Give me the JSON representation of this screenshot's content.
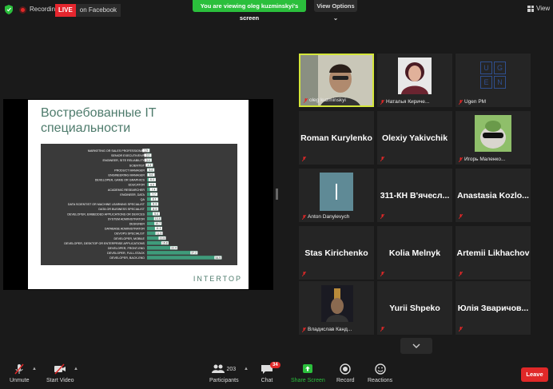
{
  "topbar": {
    "recording": "Recording",
    "live": "LIVE",
    "live_target": "on Facebook",
    "viewing_banner": "You are viewing oleg kuzminskyi's screen",
    "view_options": "View Options",
    "view": "View"
  },
  "slide": {
    "title": "Востребованные IT специальности",
    "logo": "INTERTOP"
  },
  "chart_data": {
    "type": "bar",
    "orientation": "horizontal",
    "categories": [
      "MARKETING OR SALES PROFESSIONAL",
      "SENIOR EXECUTIVE/VP",
      "ENGINEER, SITE RELIABILITY",
      "SCIENTIST",
      "PRODUCT MANAGER",
      "ENGINEERING MANAGER",
      "DEVELOPER, GAME OR GRAPHICS",
      "EDUCATOR",
      "ACADEMIC RESEARCHER",
      "ENGINEER, DATA",
      "QA",
      "DATA SCIENTIST OR MACHINE LEARNING SPECIALIST",
      "DATA OR BUSINESS SPECIALIST",
      "DEVELOPER, EMBEDDED APPLICATIONS OR DEVICES",
      "SYSTEM ADMINISTRATOR",
      "DESIGNER",
      "DATABASE ADMINISTRATOR",
      "DEVOPS SPECIALIST",
      "DEVELOPER, MOBILE",
      "DEVELOPER, DESKTOP OR ENTERPRISE APPLICATIONS",
      "DEVELOPER, FRONT-END",
      "DEVELOPER, FULL-STACK",
      "DEVELOPER, BACK-END"
    ],
    "values": [
      1.9,
      3.2,
      3.4,
      4.3,
      5.4,
      5.6,
      6.4,
      6.5,
      7.4,
      7.7,
      8.1,
      8.3,
      8.3,
      9.4,
      10.4,
      10.7,
      11.1,
      11.5,
      13.8,
      15.8,
      22.4,
      37.2,
      54.9
    ],
    "value_labels": [
      "1.9",
      "3.2",
      "3.4",
      "4.3",
      "5.4",
      "5.6",
      "6.4",
      "6.5",
      "7.4",
      "7.7",
      "8.1",
      "8.3",
      "8.3",
      "9.4",
      "10.4",
      "10.7",
      "11.1",
      "11.5",
      "13.8",
      "15.8",
      "22.4",
      "37.2",
      "54.9"
    ],
    "xlim": [
      0,
      60
    ],
    "colors": {
      "bar": "#3f9b7b",
      "background": "#3a3a3a",
      "label": "#ffffff"
    }
  },
  "gallery": {
    "tiles": [
      {
        "name": "oleg kuzminskyi",
        "active": true
      },
      {
        "name": "Наталья Кириче..."
      },
      {
        "name": "Ugen PM"
      },
      {
        "big": "Roman Kurylenko"
      },
      {
        "big": "Olexiy Yakivchik"
      },
      {
        "name": "Игорь Маленко..."
      },
      {
        "name": "Anton Danylevych"
      },
      {
        "big": "311-КН  В'ячесл..."
      },
      {
        "big": "Anastasia  Kozlo..."
      },
      {
        "big": "Stas Kirichenko"
      },
      {
        "big": "Kolia Melnyk"
      },
      {
        "big": "Artemii Likhachov"
      },
      {
        "name": "Владислав Канд..."
      },
      {
        "big": "Yurii Shpeko"
      },
      {
        "big": "Юлія  Зваричов..."
      }
    ],
    "ugen_letters": [
      "U",
      "G",
      "E",
      "N"
    ]
  },
  "toolbar": {
    "unmute": "Unmute",
    "start_video": "Start Video",
    "participants": "Participants",
    "participants_count": "203",
    "chat": "Chat",
    "chat_badge": "34",
    "share": "Share Screen",
    "record": "Record",
    "reactions": "Reactions",
    "leave": "Leave"
  },
  "colors": {
    "active_speaker": "#d4e63a",
    "share_green": "#2bbf3c",
    "danger": "#e02828"
  }
}
